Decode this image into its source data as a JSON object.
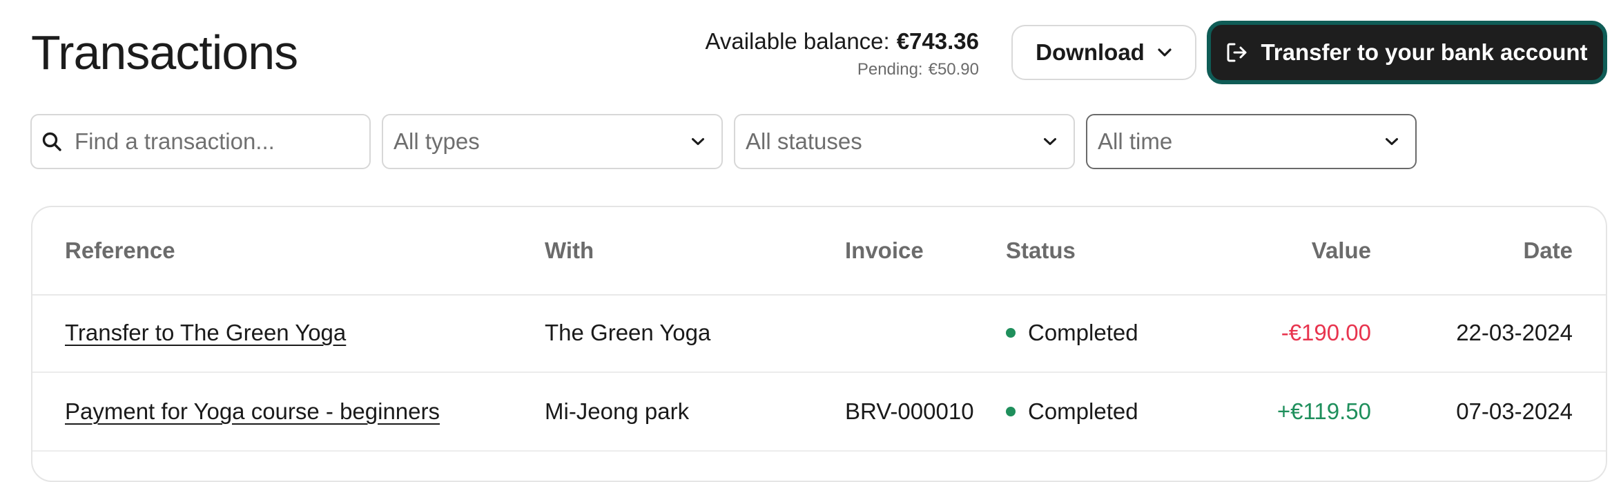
{
  "header": {
    "title": "Transactions",
    "balance_label": "Available balance:",
    "balance_value": "€743.36",
    "pending_label": "Pending:",
    "pending_value": "€50.90",
    "download_label": "Download",
    "transfer_label": "Transfer to your bank account"
  },
  "filters": {
    "search_placeholder": "Find a transaction...",
    "type_value": "All types",
    "status_value": "All statuses",
    "time_value": "All time"
  },
  "table": {
    "columns": {
      "reference": "Reference",
      "with": "With",
      "invoice": "Invoice",
      "status": "Status",
      "value": "Value",
      "date": "Date"
    },
    "rows": [
      {
        "reference": "Transfer to The Green Yoga",
        "with": "The Green Yoga",
        "invoice": "",
        "status": "Completed",
        "value": "-€190.00",
        "date": "22-03-2024"
      },
      {
        "reference": "Payment for Yoga course - beginners",
        "with": "Mi-Jeong park",
        "invoice": "BRV-000010",
        "status": "Completed",
        "value": "+€119.50",
        "date": "07-03-2024"
      }
    ]
  },
  "colors": {
    "accent_border": "#0f5c56",
    "primary_button": "#1e1e1e",
    "negative": "#e8344e",
    "positive": "#1f8f5c",
    "status_completed": "#1f8f5c"
  },
  "icons": {
    "search": "search-icon",
    "chevron": "chevron-down-icon",
    "transfer": "sign-out-icon",
    "status": "status-dot-icon"
  }
}
